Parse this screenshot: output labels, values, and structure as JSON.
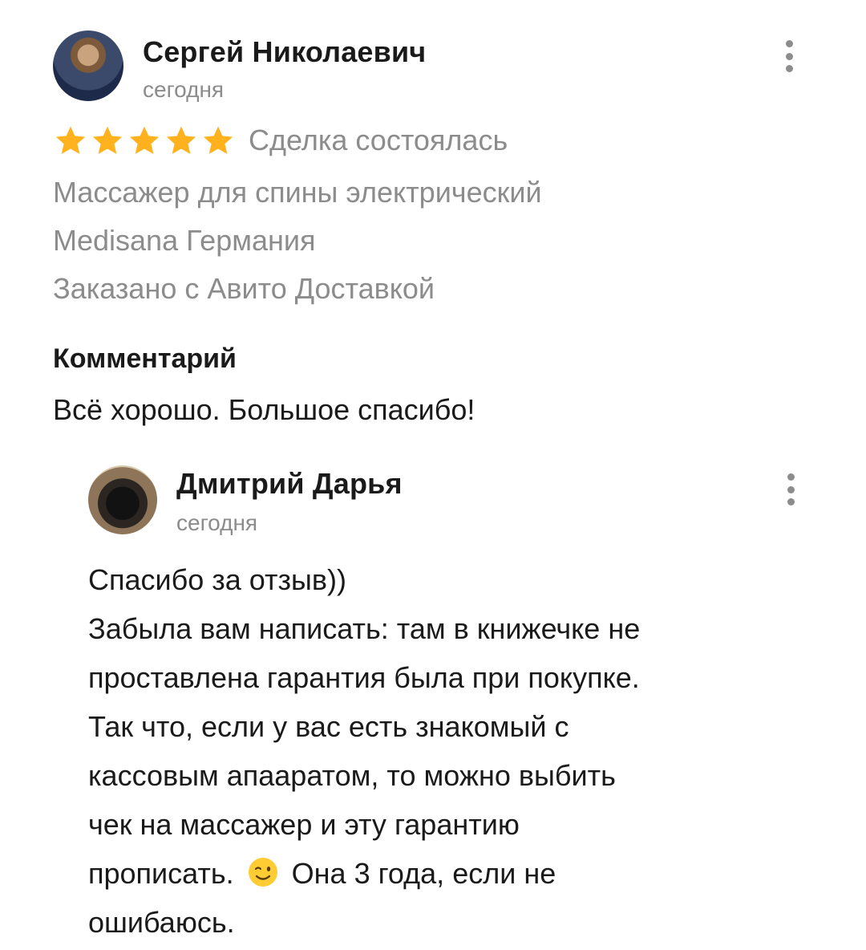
{
  "review": {
    "author": "Сергей Николаевич",
    "date": "сегодня",
    "rating": 5,
    "deal_status": "Сделка состоялась",
    "product_lines": [
      "Массажер для спины электрический",
      "Medisana Германия",
      "Заказано с Авито Доставкой"
    ],
    "comment_title": "Комментарий",
    "comment_text": "Всё хорошо. Большое спасибо!",
    "menu_icon": "more-vertical-icon"
  },
  "reply": {
    "author": "Дмитрий Дарья",
    "date": "сегодня",
    "menu_icon": "more-vertical-icon",
    "lines": [
      "Спасибо за отзыв))",
      "Забыла вам написать: там в книжечке не",
      "проставлена гарантия была при покупке.",
      "Так что, если у вас есть знакомый с",
      "кассовым апааратом, то можно выбить",
      "чек на массажер и эту гарантию",
      "прописать.",
      "Она 3 года, если не",
      "ошибаюсь."
    ],
    "emoji": "wink-emoji-icon"
  },
  "colors": {
    "star": "#ffb21e",
    "secondary_text": "#8c8c8c",
    "primary_text": "#1a1a1a"
  }
}
